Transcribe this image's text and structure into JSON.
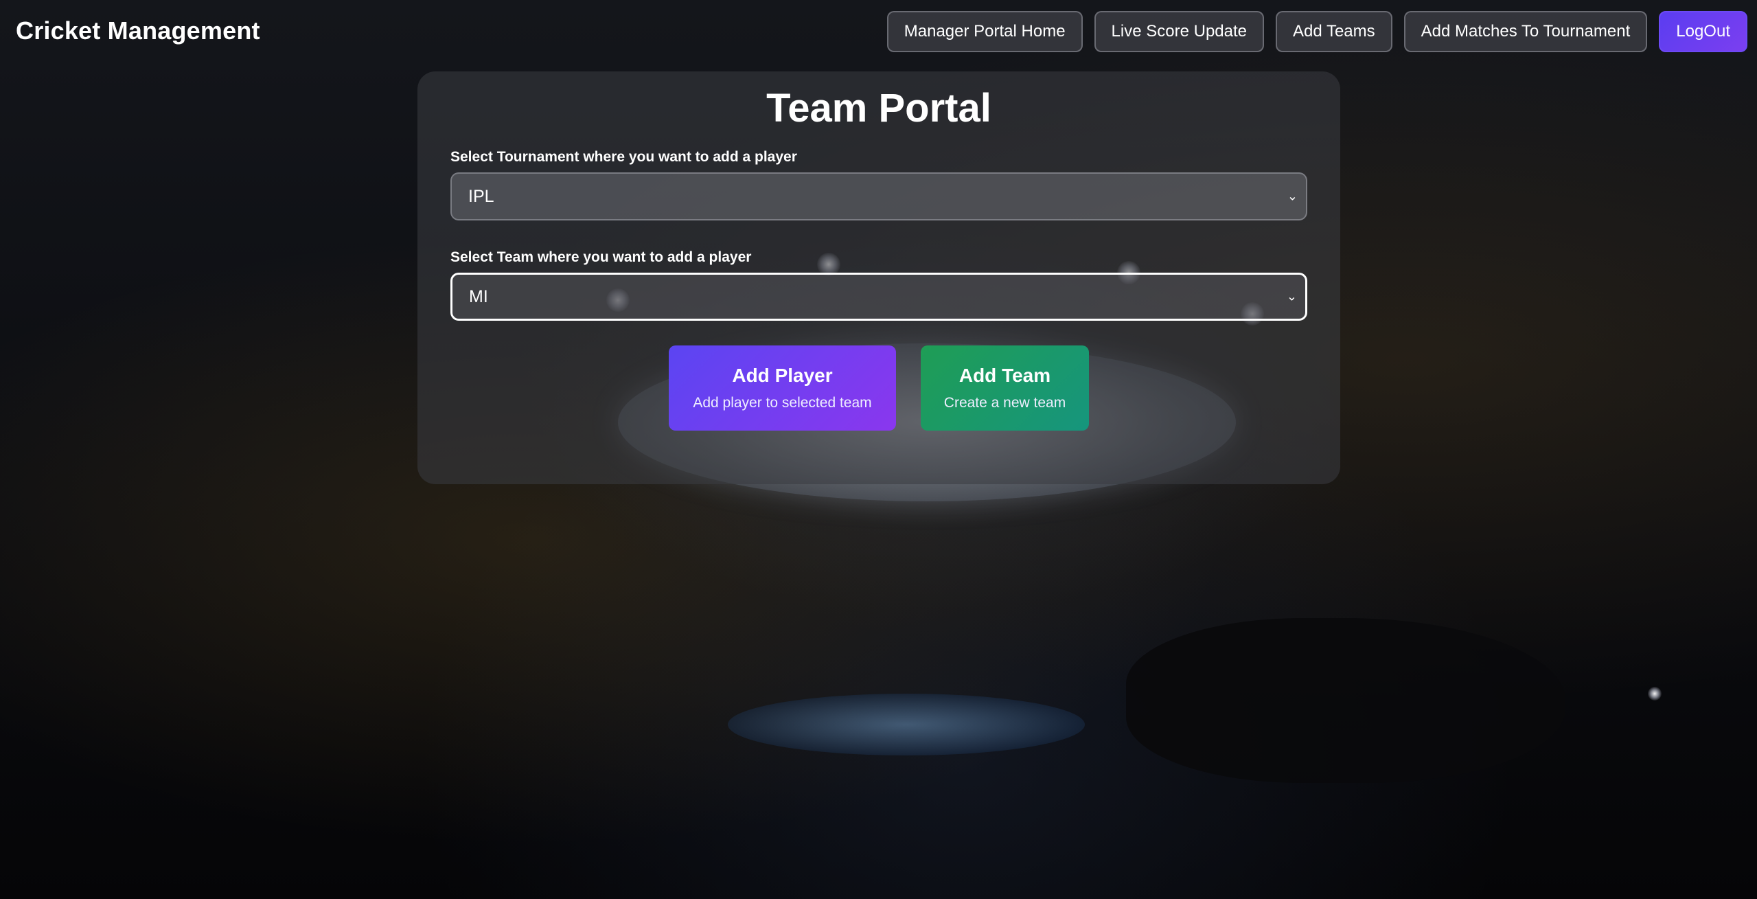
{
  "brand": {
    "title": "Cricket Management"
  },
  "nav": {
    "items": [
      {
        "label": "Manager Portal Home"
      },
      {
        "label": "Live Score Update"
      },
      {
        "label": "Add Teams"
      },
      {
        "label": "Add Matches To Tournament"
      },
      {
        "label": "LogOut"
      }
    ]
  },
  "panel": {
    "title": "Team Portal",
    "tournament": {
      "label": "Select Tournament where you want to add a player",
      "value": "IPL"
    },
    "team": {
      "label": "Select Team where you want to add a player",
      "value": "MI"
    },
    "add_player": {
      "title": "Add Player",
      "subtitle": "Add player to selected team"
    },
    "add_team": {
      "title": "Add Team",
      "subtitle": "Create a new team"
    }
  },
  "colors": {
    "logout": "#6c4af5",
    "add_player": "#7040f0",
    "add_team": "#1a9a68"
  },
  "icons": {
    "select_arrow": "chevron-down-icon"
  }
}
